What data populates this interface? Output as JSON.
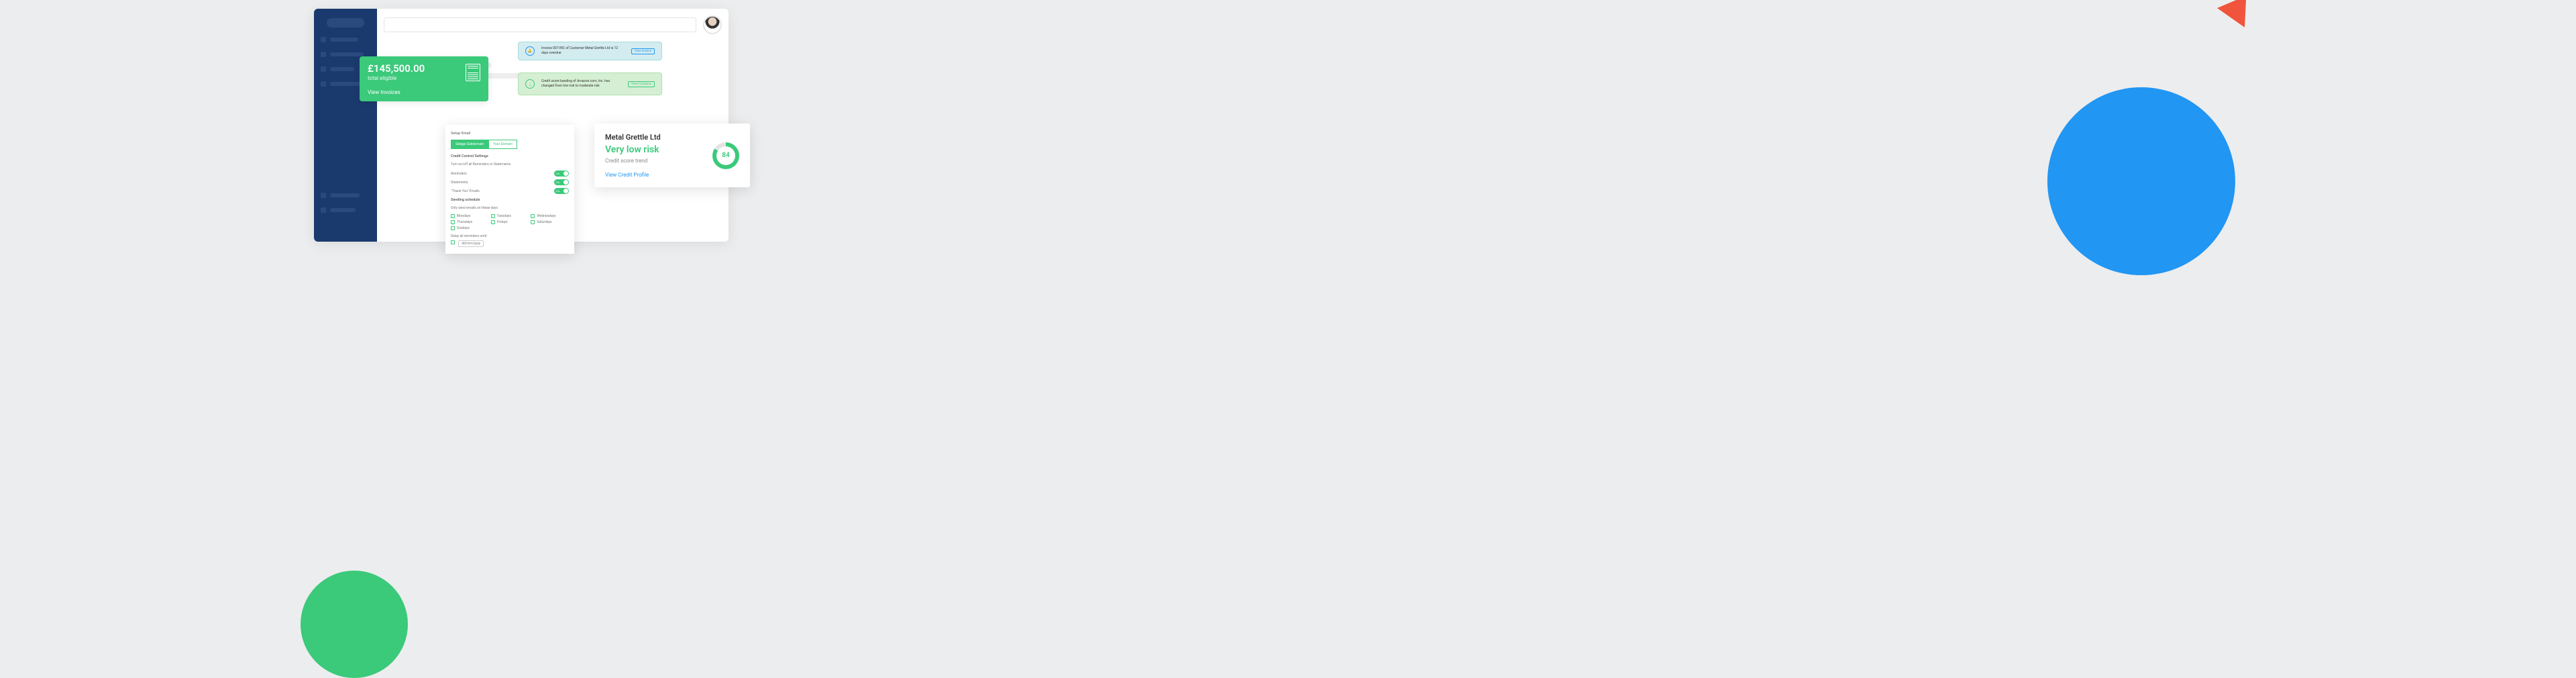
{
  "eligible": {
    "amount": "£145,500.00",
    "label": "total eligible",
    "link": "View Invoices"
  },
  "notifications": {
    "invoice": {
      "text": "Invoice 007-INC of Customer Metal Grettle Ltd is 12 days overdue",
      "button": "View Invoice"
    },
    "credit": {
      "text": "Credit score banding of Amazon.com, Inc. has changed from low risk to moderate risk",
      "button": "View Company"
    }
  },
  "settings": {
    "setup_email": "Setup Email",
    "tab_satago": "Satago Subdomain",
    "tab_domain": "Your Domain",
    "credit_control": "Credit Control Settings",
    "turn_off": "Turn on/off all Reminders or Statements",
    "reminders": "Reminders",
    "statements": "Statements",
    "thankyou": "\"Thank You\" Emails",
    "on": "On",
    "sending_schedule": "Sending schedule",
    "only_send": "Only send emails on these days",
    "days": {
      "mon": "Mondays",
      "tue": "Tuesdays",
      "wed": "Wednesdays",
      "thu": "Thursdays",
      "fri": "Fridays",
      "sat": "Saturdays",
      "sun": "Sundays"
    },
    "delay": "Delay all reminders until:",
    "date_placeholder": "dd/mm/yyyy"
  },
  "risk": {
    "company": "Metal Grettle Ltd",
    "level": "Very low risk",
    "trend": "Credit score trend",
    "link": "View Credit Profile",
    "score": "84"
  }
}
